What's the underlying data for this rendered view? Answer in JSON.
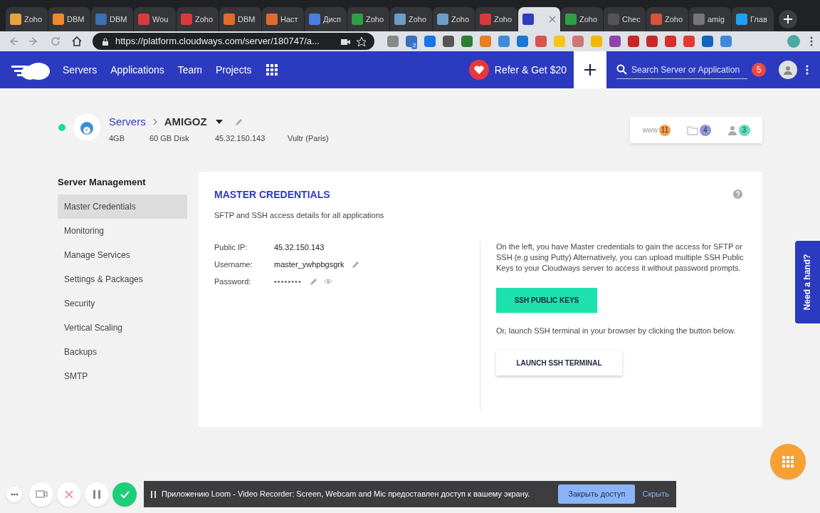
{
  "browser": {
    "tabs": [
      {
        "title": "Zoho",
        "selected": false
      },
      {
        "title": "DBM",
        "selected": false
      },
      {
        "title": "DBM",
        "selected": false
      },
      {
        "title": "Wou",
        "selected": false
      },
      {
        "title": "Zoho",
        "selected": false
      },
      {
        "title": "DBM",
        "selected": false
      },
      {
        "title": "Наст",
        "selected": false
      },
      {
        "title": "Дисп",
        "selected": false
      },
      {
        "title": "Zoho",
        "selected": false
      },
      {
        "title": "Zoho",
        "selected": false
      },
      {
        "title": "Zoho",
        "selected": false
      },
      {
        "title": "Zoho",
        "selected": false
      },
      {
        "selected": true
      },
      {
        "title": "Zoho",
        "selected": false
      },
      {
        "title": "Chec",
        "selected": false
      },
      {
        "title": "Zoho",
        "selected": false
      },
      {
        "title": "amig",
        "selected": false
      },
      {
        "title": "Глав",
        "selected": false
      }
    ],
    "url": "https://platform.cloudways.com/server/180747/a...",
    "extension_badge": "2"
  },
  "nav": {
    "items": [
      "Servers",
      "Applications",
      "Team",
      "Projects"
    ],
    "refer": "Refer & Get $20",
    "search_placeholder": "Search Server or Application",
    "notifications": "5"
  },
  "server": {
    "online": true,
    "breadcrumb": "Servers",
    "name": "AMIGOZ",
    "specs": [
      "4GB",
      "60 GB Disk",
      "45.32.150.143",
      "Vultr (Paris)"
    ],
    "counters": [
      {
        "kind": "www",
        "label": "www",
        "count": "11",
        "color": "#f5a04a"
      },
      {
        "kind": "folder",
        "count": "4",
        "color": "#8e96d6"
      },
      {
        "kind": "user",
        "count": "3",
        "color": "#5fe0c0"
      }
    ]
  },
  "sidebar": {
    "title": "Server Management",
    "items": [
      {
        "label": "Master Credentials",
        "selected": true
      },
      {
        "label": "Monitoring",
        "selected": false
      },
      {
        "label": "Manage Services",
        "selected": false
      },
      {
        "label": "Settings & Packages",
        "selected": false
      },
      {
        "label": "Security",
        "selected": false
      },
      {
        "label": "Vertical Scaling",
        "selected": false
      },
      {
        "label": "Backups",
        "selected": false
      },
      {
        "label": "SMTP",
        "selected": false
      }
    ]
  },
  "card": {
    "title": "MASTER CREDENTIALS",
    "subtitle": "SFTP and SSH access details for all applications",
    "fields": [
      {
        "label": "Public IP:",
        "value": "45.32.150.143",
        "editable": false,
        "reveal": false
      },
      {
        "label": "Username:",
        "value": "master_ywhpbgsgrk",
        "editable": true,
        "reveal": false
      },
      {
        "label": "Password:",
        "value": "••••••••",
        "editable": true,
        "reveal": true
      }
    ],
    "info": "On the left, you have Master credentials to gain the access for SFTP or SSH (e.g using Putty) Alternatively, you can upload multiple SSH Public Keys to your Cloudways server to access it without password prompts.",
    "keys_button": "SSH PUBLIC KEYS",
    "terminal_info": "Or, launch SSH terminal in your browser by clicking the button below.",
    "terminal_button": "LAUNCH SSH TERMINAL"
  },
  "help_tab": "Need a hand?",
  "loom": {
    "message": "Приложению Loom - Video Recorder: Screen, Webcam and Mic предоставлен доступ к вашему экрану.",
    "stop_button": "Закрыть доступ",
    "hide_link": "Скрыть"
  }
}
